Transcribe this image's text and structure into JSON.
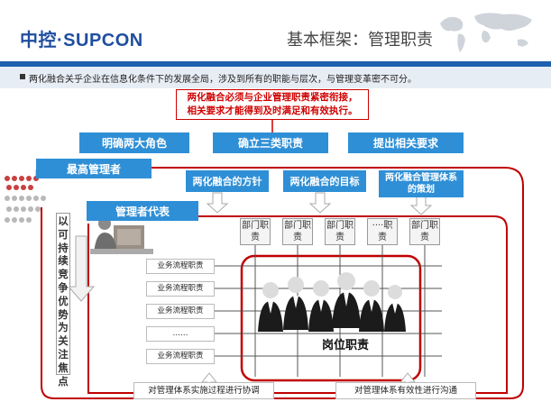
{
  "header": {
    "logo": "中控·SUPCON",
    "title": "基本框架：管理职责"
  },
  "subtitle": "两化融合关乎企业在信息化条件下的发展全局，涉及到所有的职能与层次，与管理变革密不可分。",
  "statement": {
    "line1": "两化融合必须与企业管理职责紧密衔接，",
    "line2": "相关要求才能得到及时满足和有效执行。"
  },
  "pillars": [
    "明确两大角色",
    "确立三类职责",
    "提出相关要求"
  ],
  "roles": {
    "top": "最高管理者",
    "rep": "管理者代表"
  },
  "focus": "以可持续竞争优势为关注焦点",
  "items": [
    "两化融合的方针",
    "两化融合的目标",
    "两化融合管理体系的策划"
  ],
  "departments": [
    "部门职责",
    "部门职责",
    "部门职责",
    "····职责",
    "部门职责"
  ],
  "flows": [
    "业务流程职责",
    "业务流程职责",
    "业务流程职责",
    "……",
    "业务流程职责"
  ],
  "post": "岗位职责",
  "bottom": {
    "left": "对管理体系实施过程进行协调",
    "right": "对管理体系有效性进行沟通"
  },
  "colors": {
    "brand_blue": "#1f4ea0",
    "accent_blue": "#2f8fd6",
    "accent_red": "#c00000"
  }
}
